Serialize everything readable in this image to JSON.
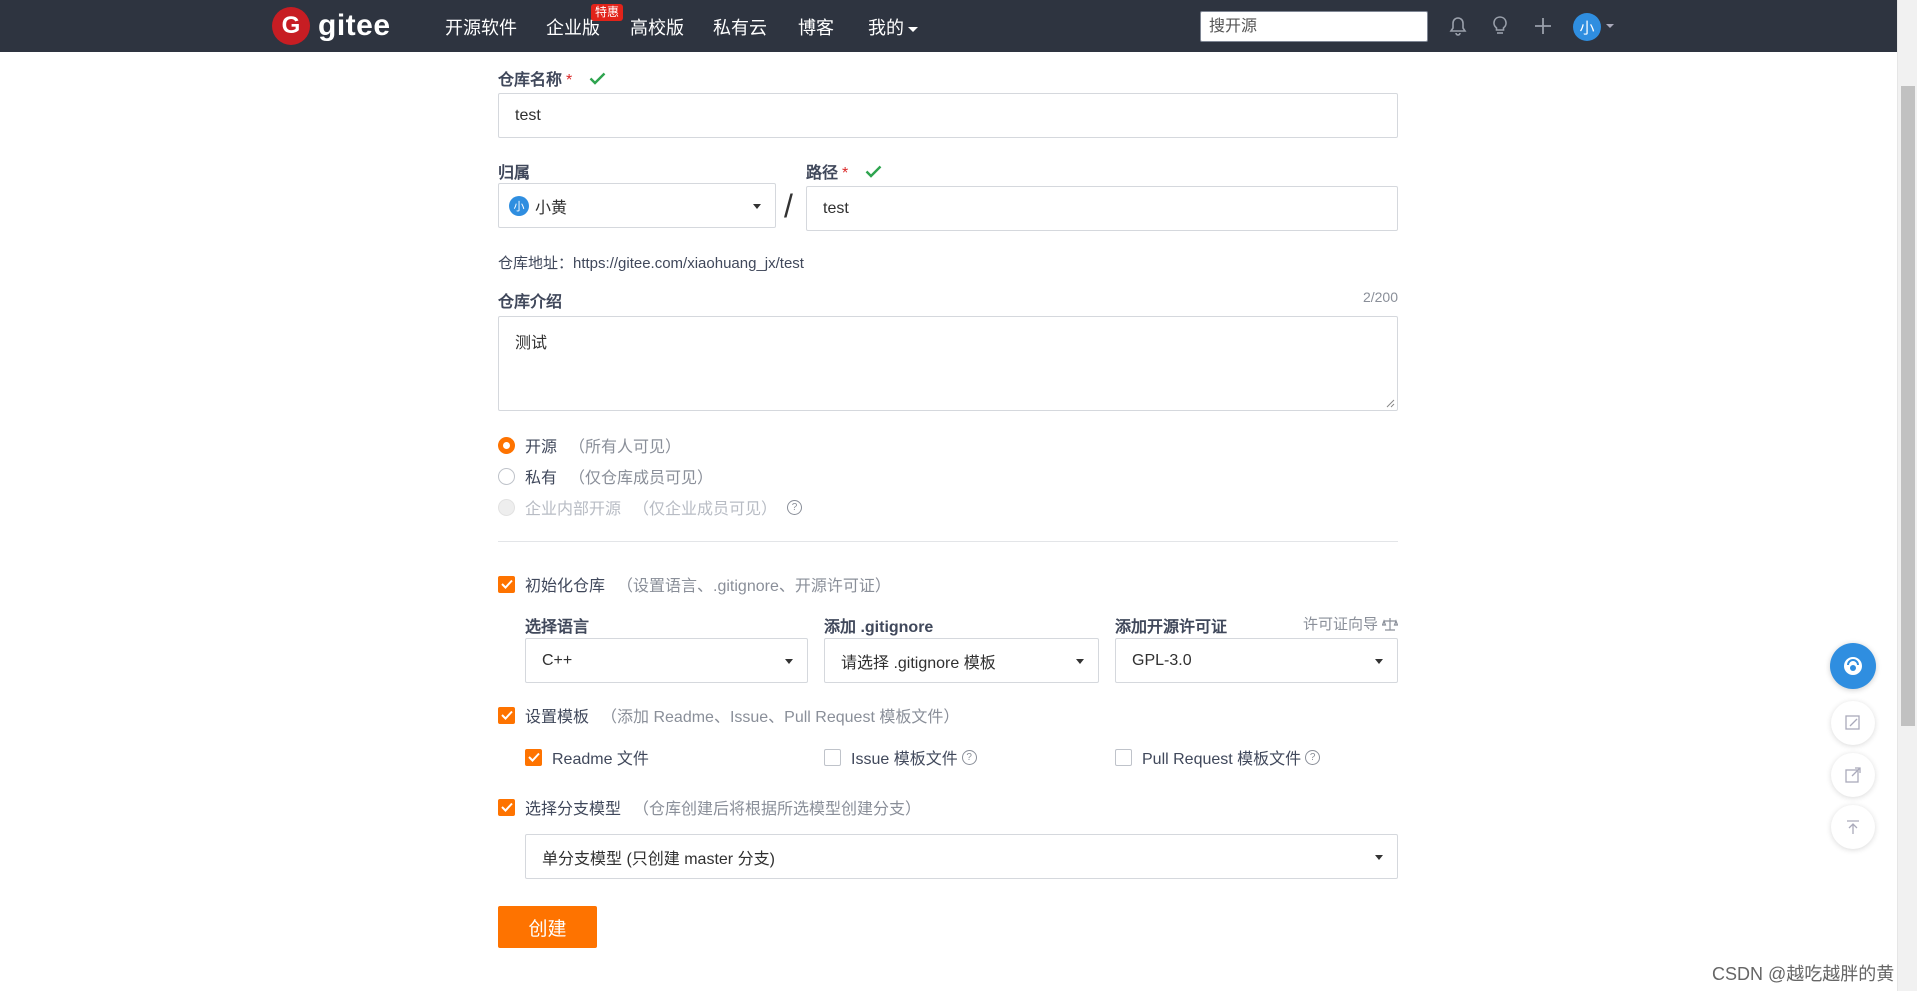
{
  "nav": {
    "logo_mark": "G",
    "logo_text": "gitee",
    "items": [
      "开源软件",
      "企业版",
      "高校版",
      "私有云",
      "博客",
      "我的"
    ],
    "badge": "特惠",
    "search_placeholder": "搜开源",
    "avatar": "小"
  },
  "form": {
    "repo_name_label": "仓库名称",
    "required_mark": "*",
    "repo_name_value": "test",
    "owner_label": "归属",
    "owner_avatar": "小",
    "owner_value": "小黄",
    "slash": "/",
    "path_label": "路径",
    "path_value": "test",
    "repo_address": "仓库地址：https://gitee.com/xiaohuang_jx/test",
    "intro_label": "仓库介绍",
    "intro_counter": "2/200",
    "intro_value": "测试",
    "visibility": [
      {
        "label": "开源",
        "hint": "（所有人可见）",
        "checked": true,
        "disabled": false
      },
      {
        "label": "私有",
        "hint": "（仅仓库成员可见）",
        "checked": false,
        "disabled": false
      },
      {
        "label": "企业内部开源",
        "hint": "（仅企业成员可见）",
        "checked": false,
        "disabled": true
      }
    ],
    "help_glyph": "?",
    "init_repo": {
      "label": "初始化仓库",
      "hint": "（设置语言、.gitignore、开源许可证）",
      "checked": true
    },
    "lang_label": "选择语言",
    "lang_value": "C++",
    "gitignore_label": "添加 .gitignore",
    "gitignore_value": "请选择 .gitignore 模板",
    "license_label": "添加开源许可证",
    "license_guide": "许可证向导",
    "license_value": "GPL-3.0",
    "template": {
      "label": "设置模板",
      "hint": "（添加 Readme、Issue、Pull Request 模板文件）",
      "checked": true
    },
    "template_files": [
      {
        "label": "Readme 文件",
        "checked": true
      },
      {
        "label": "Issue 模板文件",
        "checked": false
      },
      {
        "label": "Pull Request 模板文件",
        "checked": false
      }
    ],
    "branch": {
      "label": "选择分支模型",
      "hint": "（仓库创建后将根据所选模型创建分支）",
      "checked": true
    },
    "branch_value": "单分支模型 (只创建 master 分支)",
    "create_button": "创建"
  },
  "watermark": "CSDN @越吃越胖的黄",
  "colors": {
    "accent": "#fe7300",
    "nav_bg": "#2e3440",
    "ok_green": "#2ea44f",
    "required_red": "#db2828"
  }
}
